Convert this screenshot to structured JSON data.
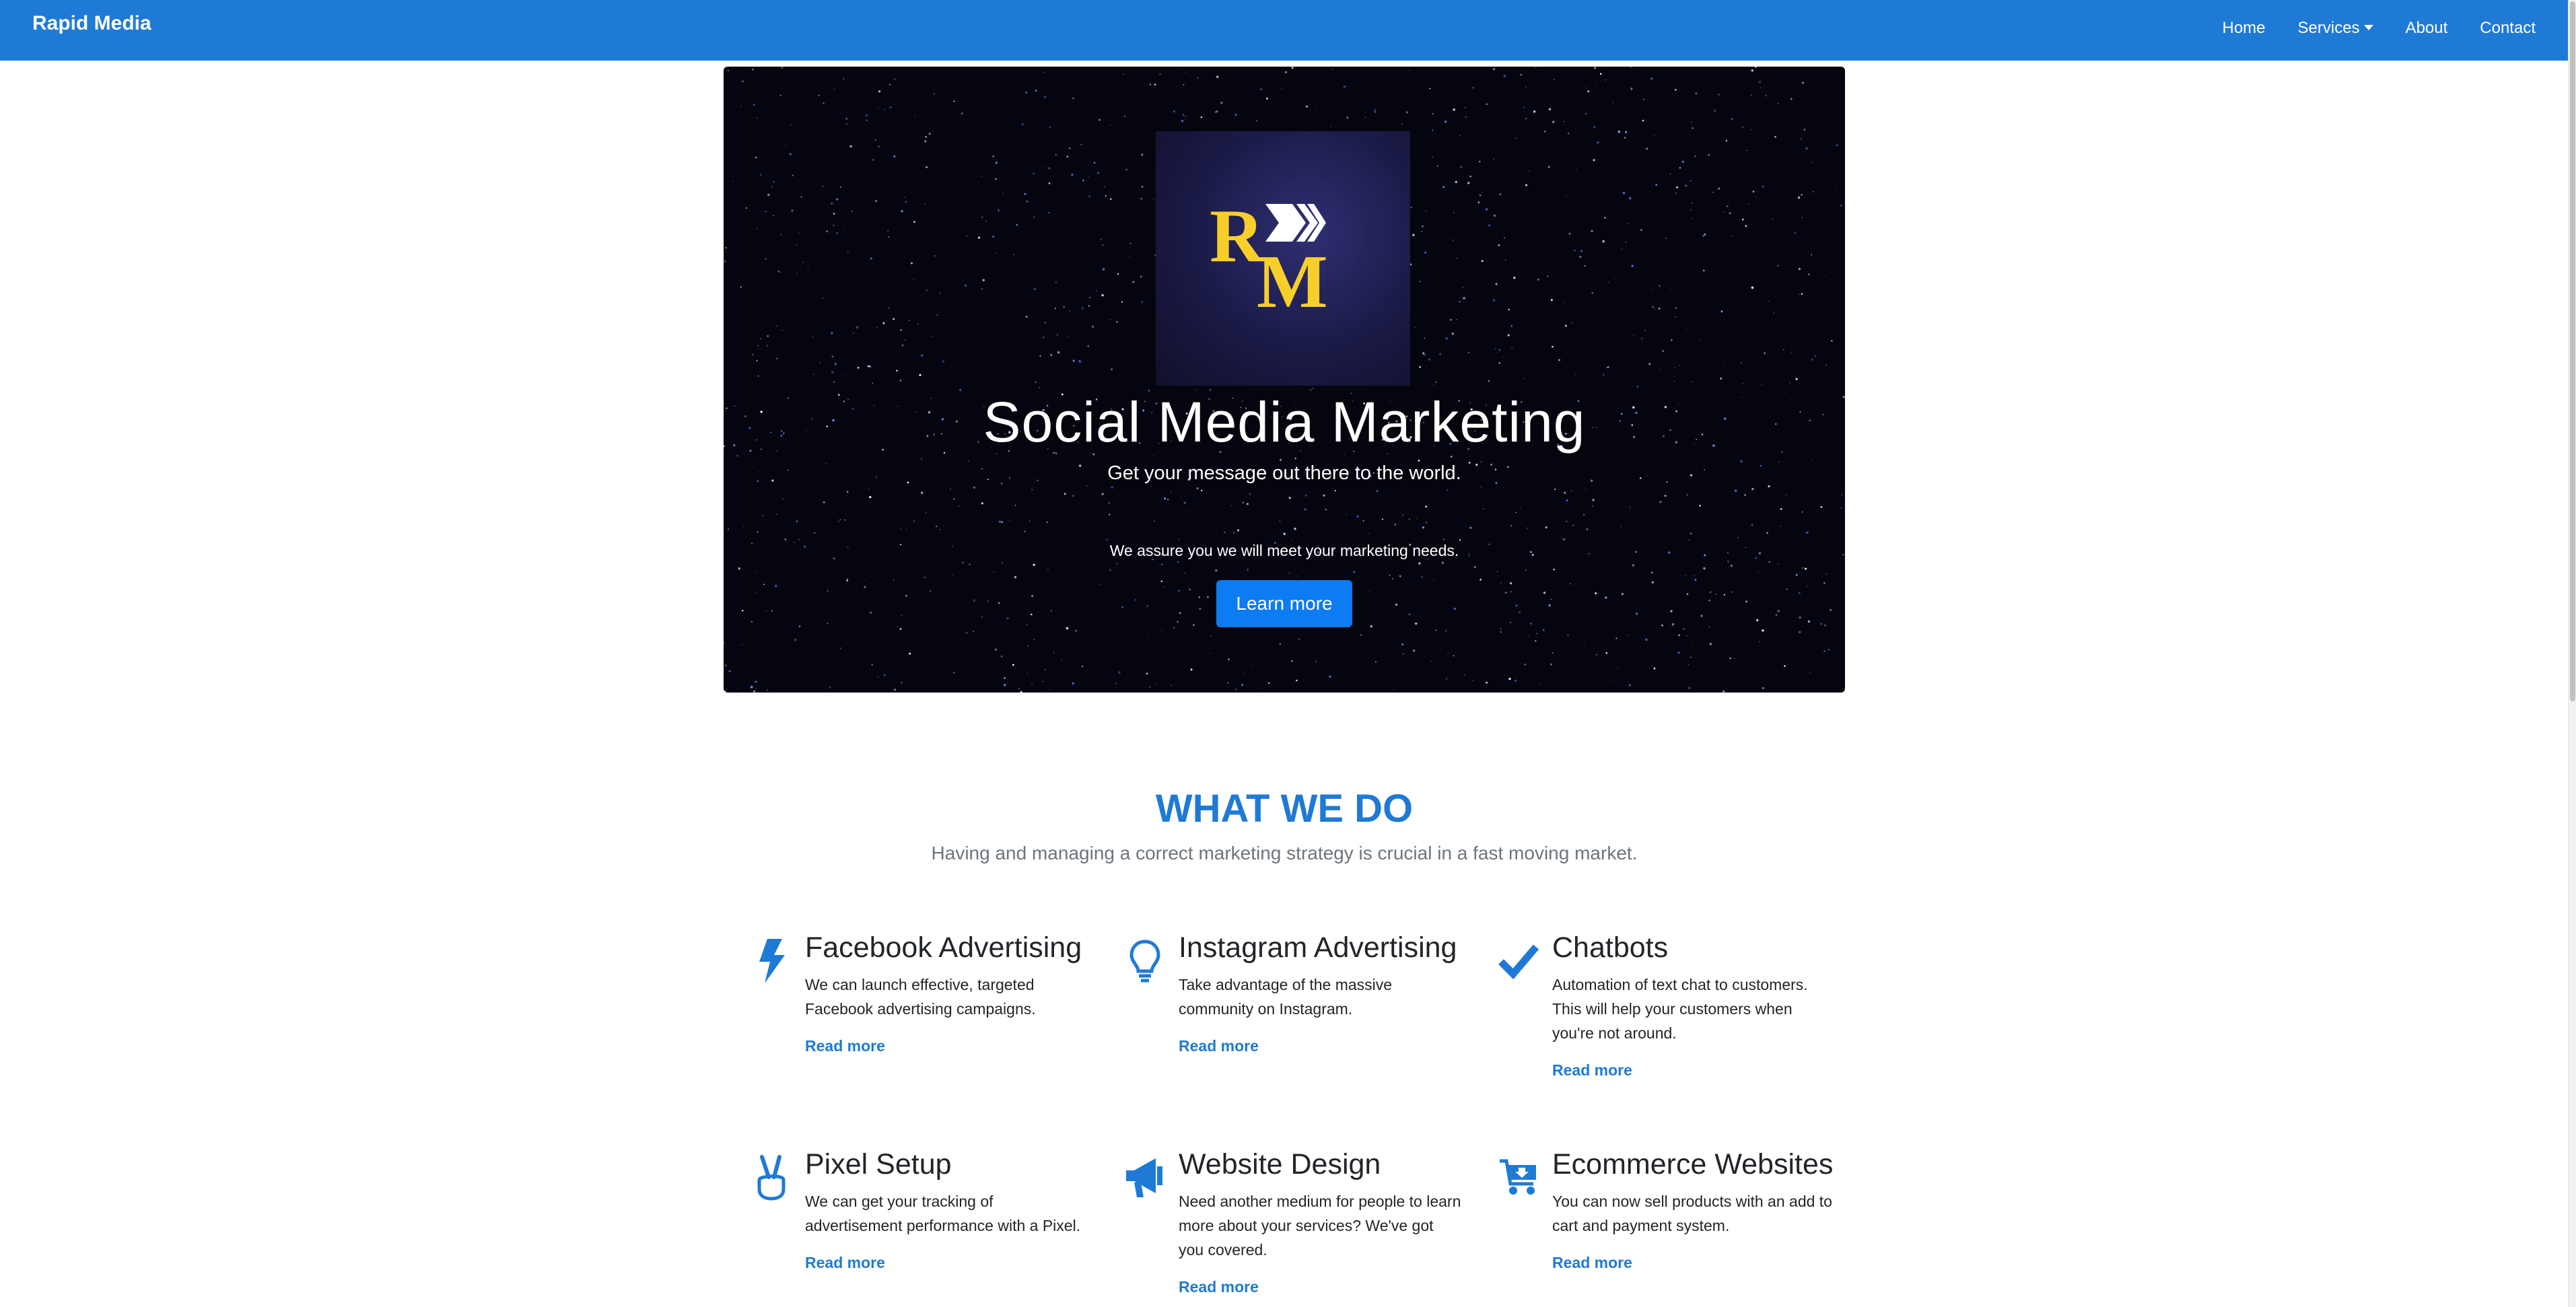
{
  "navbar": {
    "brand": "Rapid Media",
    "links": [
      {
        "label": "Home"
      },
      {
        "label": "Services"
      },
      {
        "label": "About"
      },
      {
        "label": "Contact"
      }
    ]
  },
  "hero": {
    "logo_text": "RM",
    "title": "Social Media Marketing",
    "subtitle": "Get your message out there to the world.",
    "assurance": "We assure you we will meet your marketing needs.",
    "button": "Learn more",
    "colors": {
      "logo": "#f8cf2a",
      "button": "#0d7bf2",
      "background": "#05050f"
    }
  },
  "what_we_do": {
    "title": "WHAT WE DO",
    "subtitle": "Having and managing a correct marketing strategy is crucial in a fast moving market.",
    "services": [
      {
        "icon": "lightning-bolt-icon",
        "title": "Facebook Advertising",
        "text": "We can launch effective, targeted Facebook advertising campaigns.",
        "link": "Read more"
      },
      {
        "icon": "lightbulb-icon",
        "title": "Instagram Advertising",
        "text": "Take advantage of the massive community on Instagram.",
        "link": "Read more"
      },
      {
        "icon": "checkmark-icon",
        "title": "Chatbots",
        "text": "Automation of text chat to customers. This will help your customers when you're not around.",
        "link": "Read more"
      },
      {
        "icon": "peace-hand-icon",
        "title": "Pixel Setup",
        "text": "We can get your tracking of advertisement performance with a Pixel.",
        "link": "Read more"
      },
      {
        "icon": "megaphone-icon",
        "title": "Website Design",
        "text": "Need another medium for people to learn more about your services? We've got you covered.",
        "link": "Read more"
      },
      {
        "icon": "shopping-cart-icon",
        "title": "Ecommerce Websites",
        "text": "You can now sell products with an add to cart and payment system.",
        "link": "Read more"
      }
    ]
  },
  "colors": {
    "primary": "#1f7ad6",
    "muted": "#6c757d"
  }
}
